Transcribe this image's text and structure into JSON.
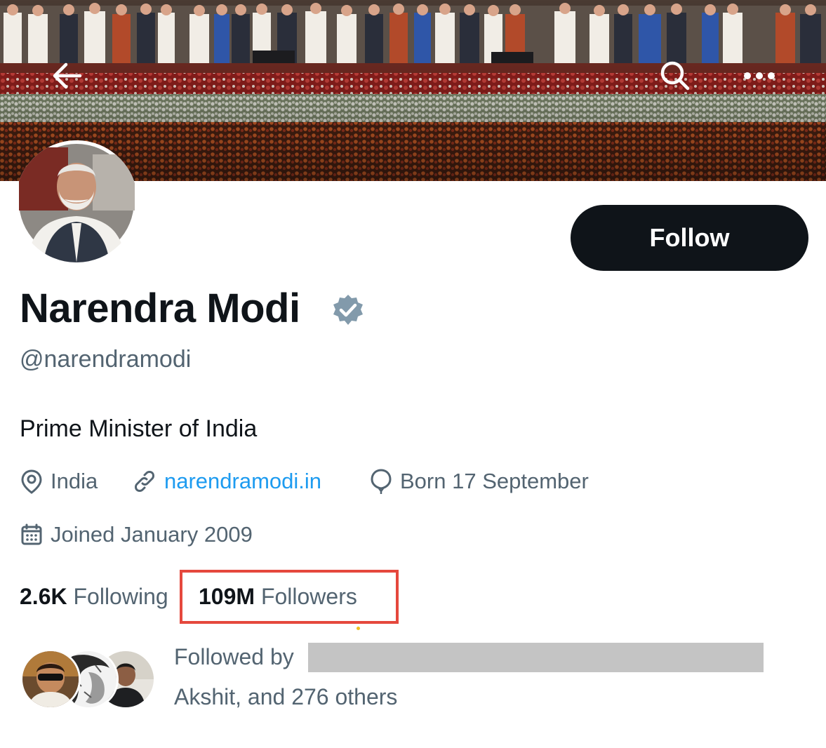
{
  "profile": {
    "display_name": "Narendra Modi",
    "handle": "@narendramodi",
    "bio": "Prime Minister of India",
    "location": "India",
    "website": "narendramodi.in",
    "birthday": "Born 17 September",
    "joined": "Joined January 2009",
    "verified": true
  },
  "actions": {
    "follow_label": "Follow"
  },
  "stats": {
    "following_count": "2.6K",
    "following_label": "Following",
    "followers_count": "109M",
    "followers_label": "Followers"
  },
  "followed_by": {
    "prefix": "Followed by",
    "line2": "Akshit, and 276 others"
  },
  "icons": {
    "back": "arrow-left-icon",
    "search": "search-icon",
    "more": "more-horizontal-icon",
    "verified": "verified-badge-icon",
    "location": "location-pin-icon",
    "website": "link-icon",
    "birthday": "balloon-icon",
    "joined": "calendar-icon"
  },
  "colors": {
    "text_primary": "#0f1419",
    "text_secondary": "#536471",
    "link": "#1d9bf0",
    "follow_button_bg": "#0f1419",
    "highlight_box": "#e5483d",
    "verified_badge": "#829aab"
  }
}
